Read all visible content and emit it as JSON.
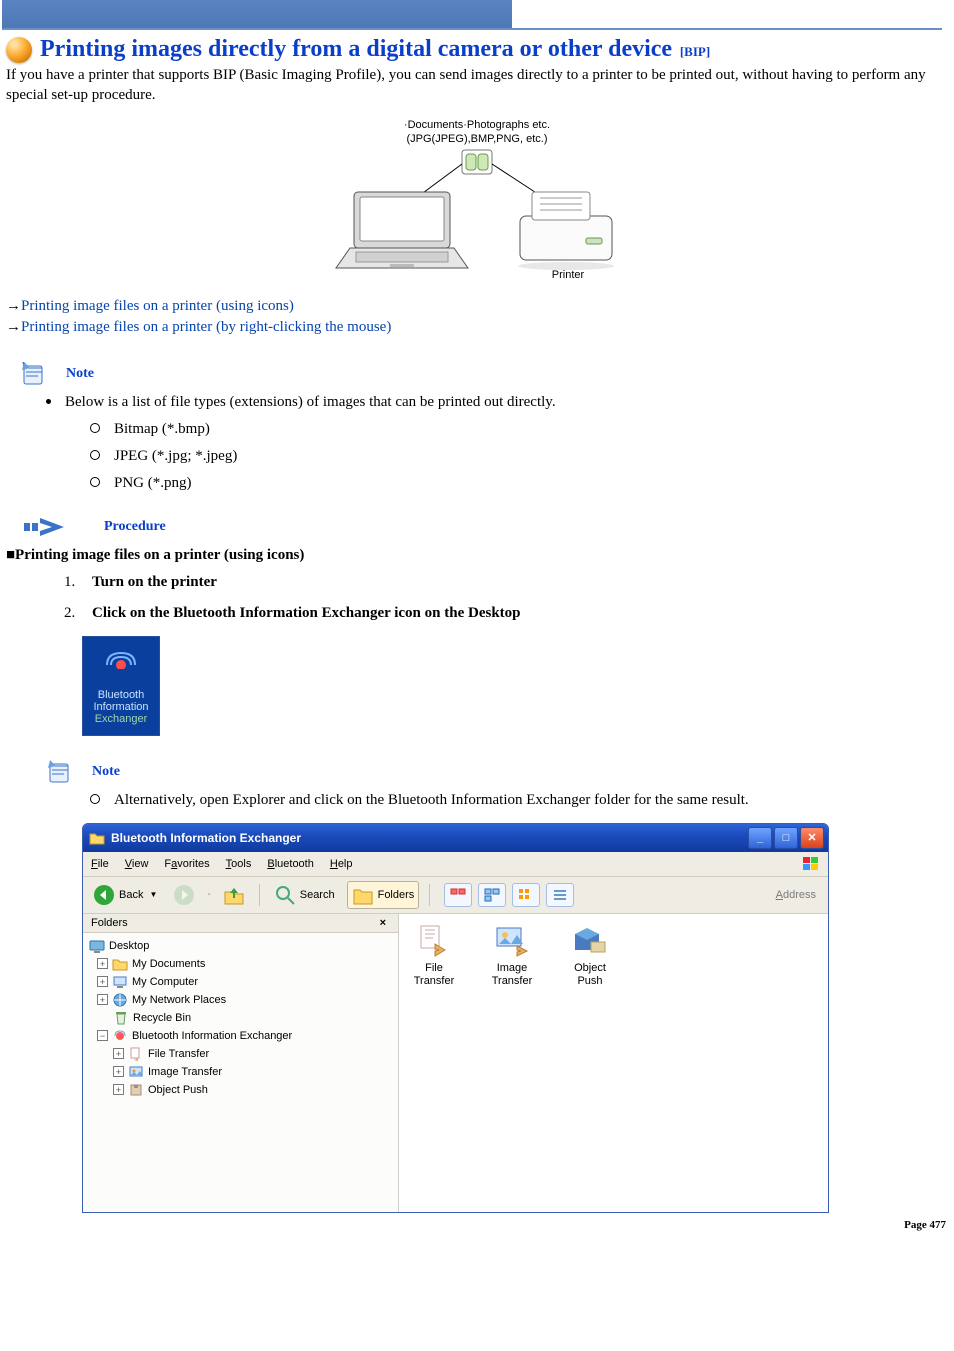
{
  "title": "Printing images directly from a digital camera or other device",
  "title_tag": "[BIP]",
  "intro": "If you have a printer that supports BIP (Basic Imaging Profile), you can send images directly to a printer to be printed out, without having to perform any special set-up procedure.",
  "diagram_caption_line1": "·Documents·Photographs etc.",
  "diagram_caption_line2": "(JPG(JPEG),BMP,PNG, etc.)",
  "diagram_printer_label": "Printer",
  "links": {
    "arrow": "→",
    "l1": "Printing image files on a printer (using icons)",
    "l2": "Printing image files on a printer (by right-clicking the mouse)"
  },
  "note_label": "Note",
  "note_text": "Below is a list of file types (extensions) of images that can be printed out directly.",
  "filetypes": {
    "a": "Bitmap (*.bmp)",
    "b": "JPEG (*.jpg; *.jpeg)",
    "c": "PNG (*.png)"
  },
  "procedure_label": "Procedure",
  "section1_title": "■Printing image files on a printer (using icons)",
  "steps": {
    "s1_num": "1.",
    "s1": "Turn on the printer",
    "s2_num": "2.",
    "s2": "Click on the Bluetooth Information Exchanger icon on the Desktop"
  },
  "bt_icon": {
    "line1": "Bluetooth",
    "line2": "Information",
    "line3": "Exchanger"
  },
  "note2_text": "Alternatively, open Explorer and click on the Bluetooth Information Exchanger folder for the same result.",
  "window": {
    "title": "Bluetooth Information Exchanger",
    "menus": {
      "file": "File",
      "view": "View",
      "fav": "Favorites",
      "tools": "Tools",
      "bt": "Bluetooth",
      "help": "Help"
    },
    "toolbar": {
      "back": "Back",
      "search": "Search",
      "folders": "Folders",
      "address": "Address"
    },
    "folders_header": "Folders",
    "tree": {
      "desktop": "Desktop",
      "mydocs": "My Documents",
      "mycomp": "My Computer",
      "mynet": "My Network Places",
      "recycle": "Recycle Bin",
      "bie": "Bluetooth Information Exchanger",
      "ft": "File Transfer",
      "it": "Image Transfer",
      "op": "Object Push"
    },
    "content": {
      "ft": "File Transfer",
      "it_line1": "Image",
      "it_line2": "Transfer",
      "op": "Object Push"
    }
  },
  "page_number": "Page 477"
}
